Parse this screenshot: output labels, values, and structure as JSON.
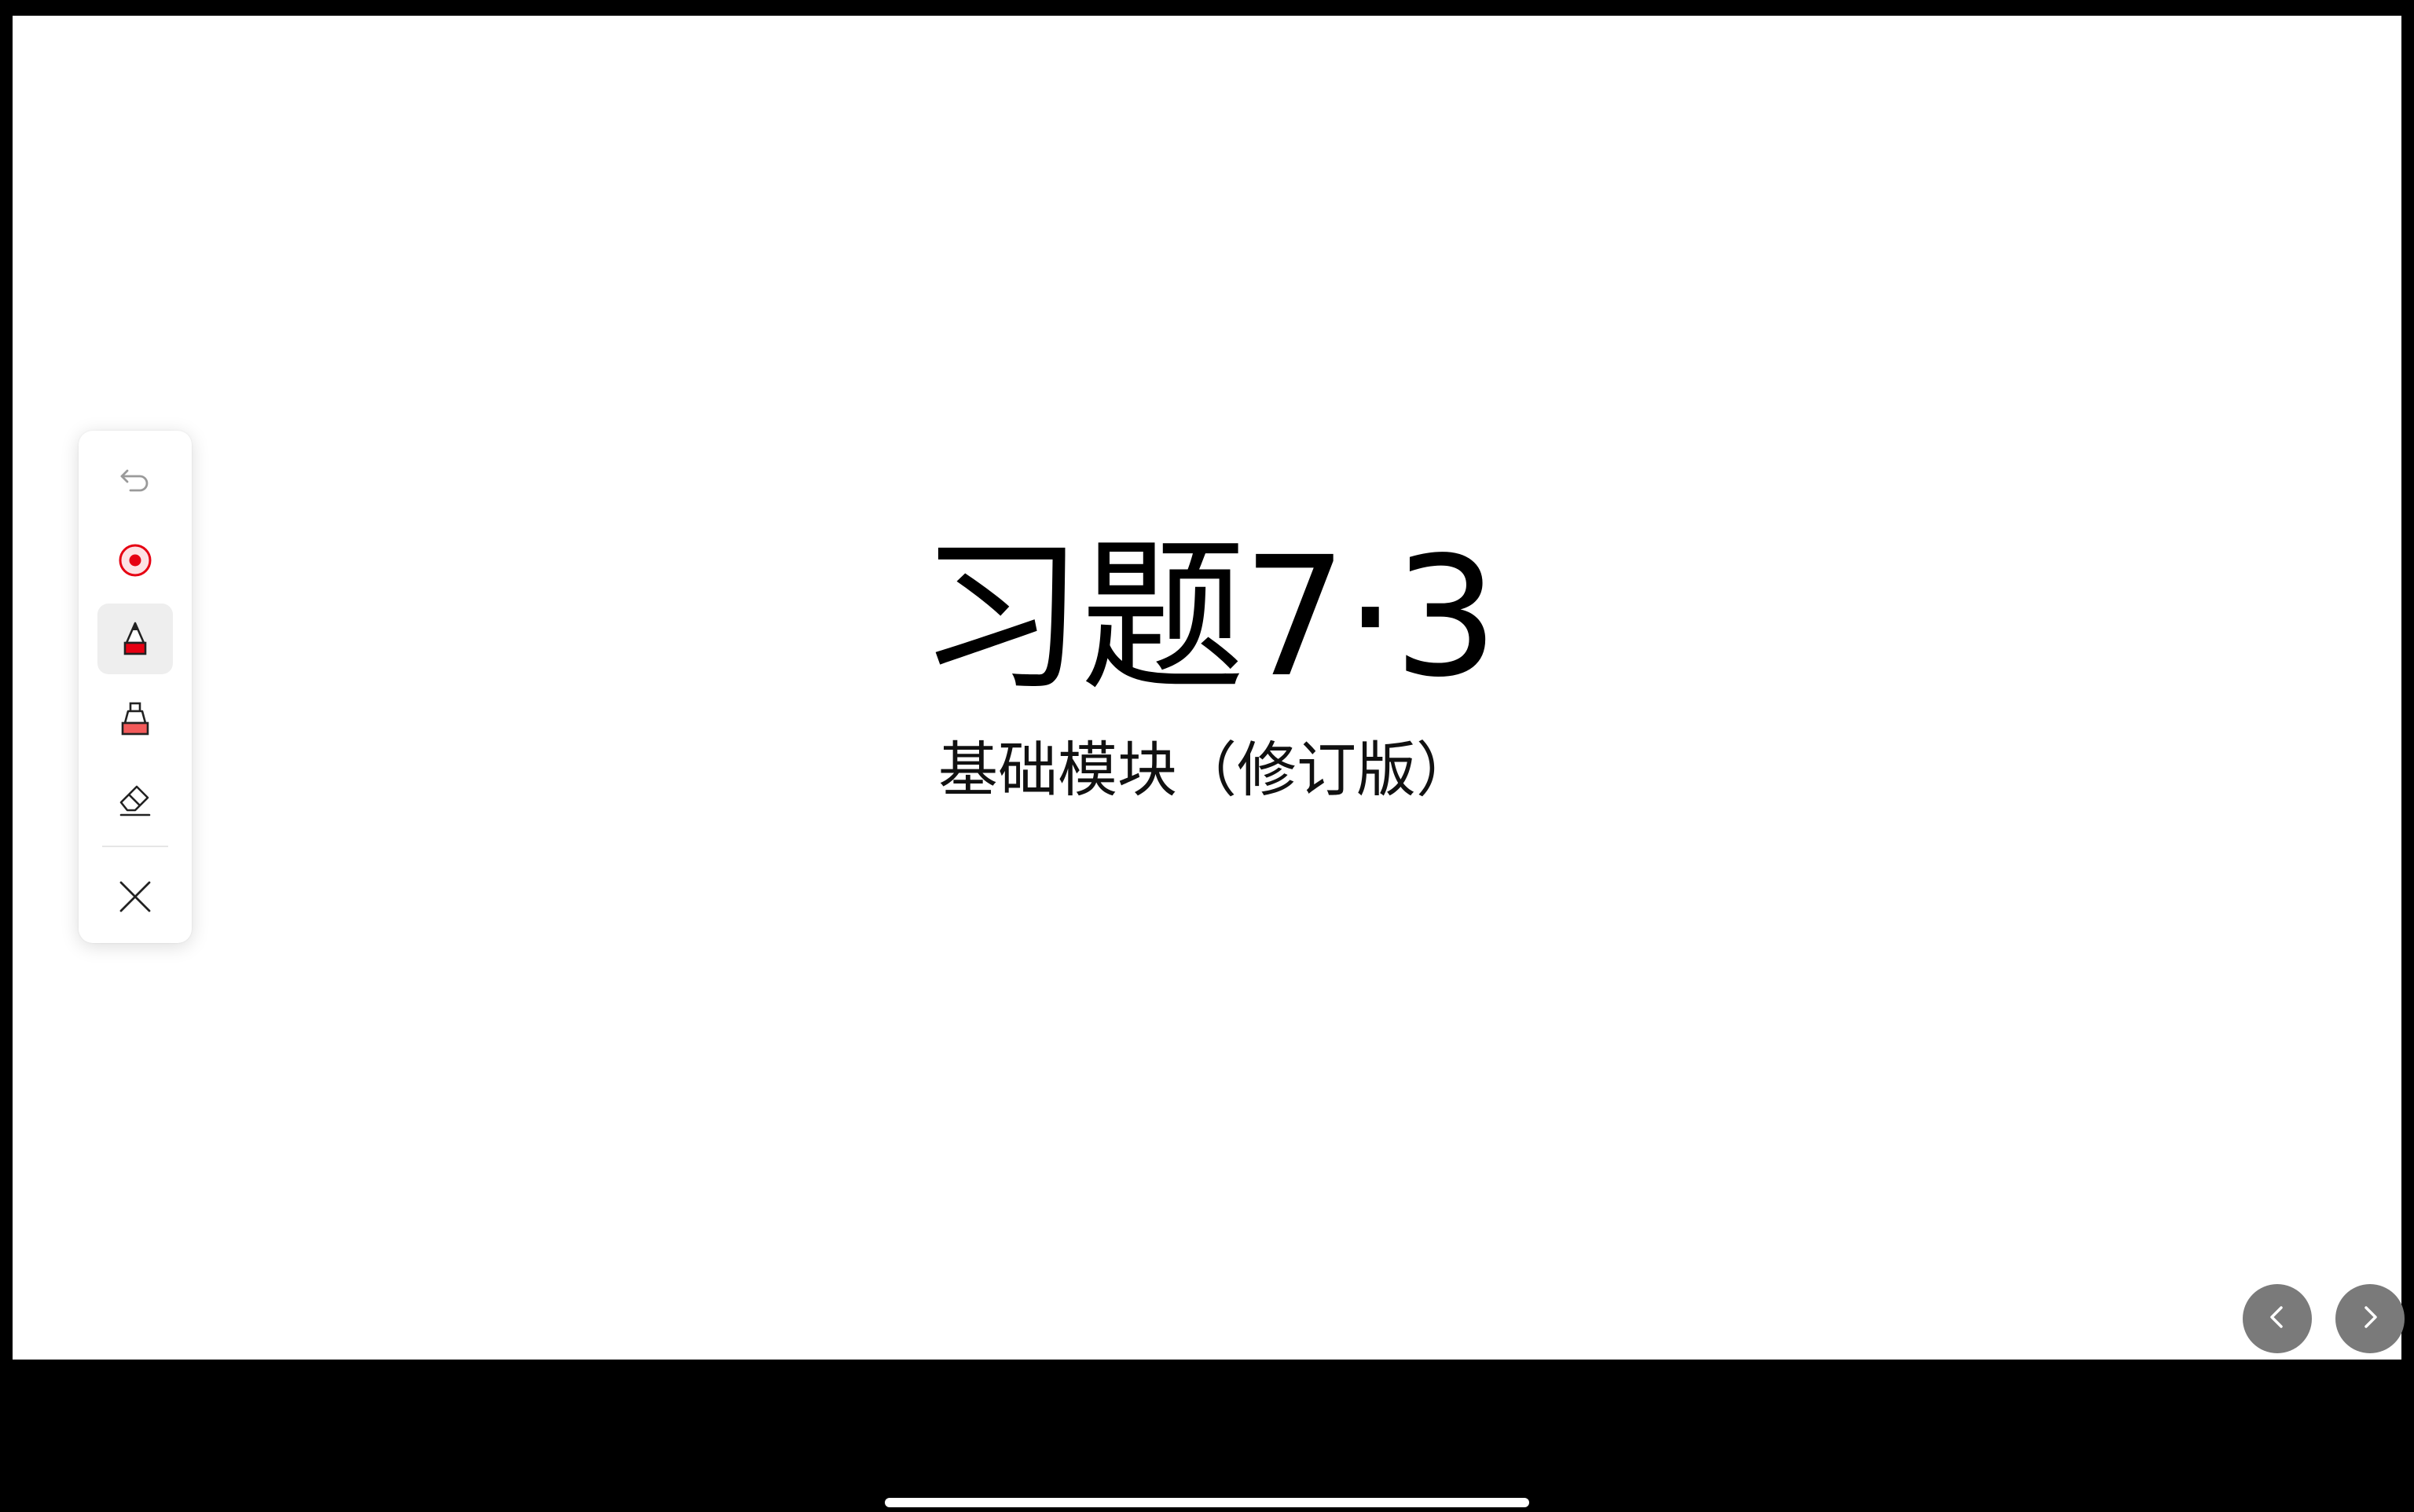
{
  "slide": {
    "title": "习题7·3",
    "subtitle": "基础模块（修订版）"
  },
  "toolbar": {
    "tools": [
      {
        "name": "undo",
        "icon": "undo-icon",
        "state": "disabled"
      },
      {
        "name": "laser-pointer",
        "icon": "laser-pointer-icon"
      },
      {
        "name": "pen",
        "icon": "pen-icon",
        "state": "selected"
      },
      {
        "name": "highlighter",
        "icon": "highlighter-icon"
      },
      {
        "name": "eraser",
        "icon": "eraser-icon"
      },
      {
        "name": "close",
        "icon": "close-icon"
      }
    ]
  },
  "navigation": {
    "previous_icon": "chevron-left-icon",
    "next_icon": "chevron-right-icon"
  },
  "colors": {
    "accent_red": "#e60012",
    "nav_button": "#7a7a7a",
    "screen_background": "#000000",
    "slide_background": "#ffffff"
  }
}
